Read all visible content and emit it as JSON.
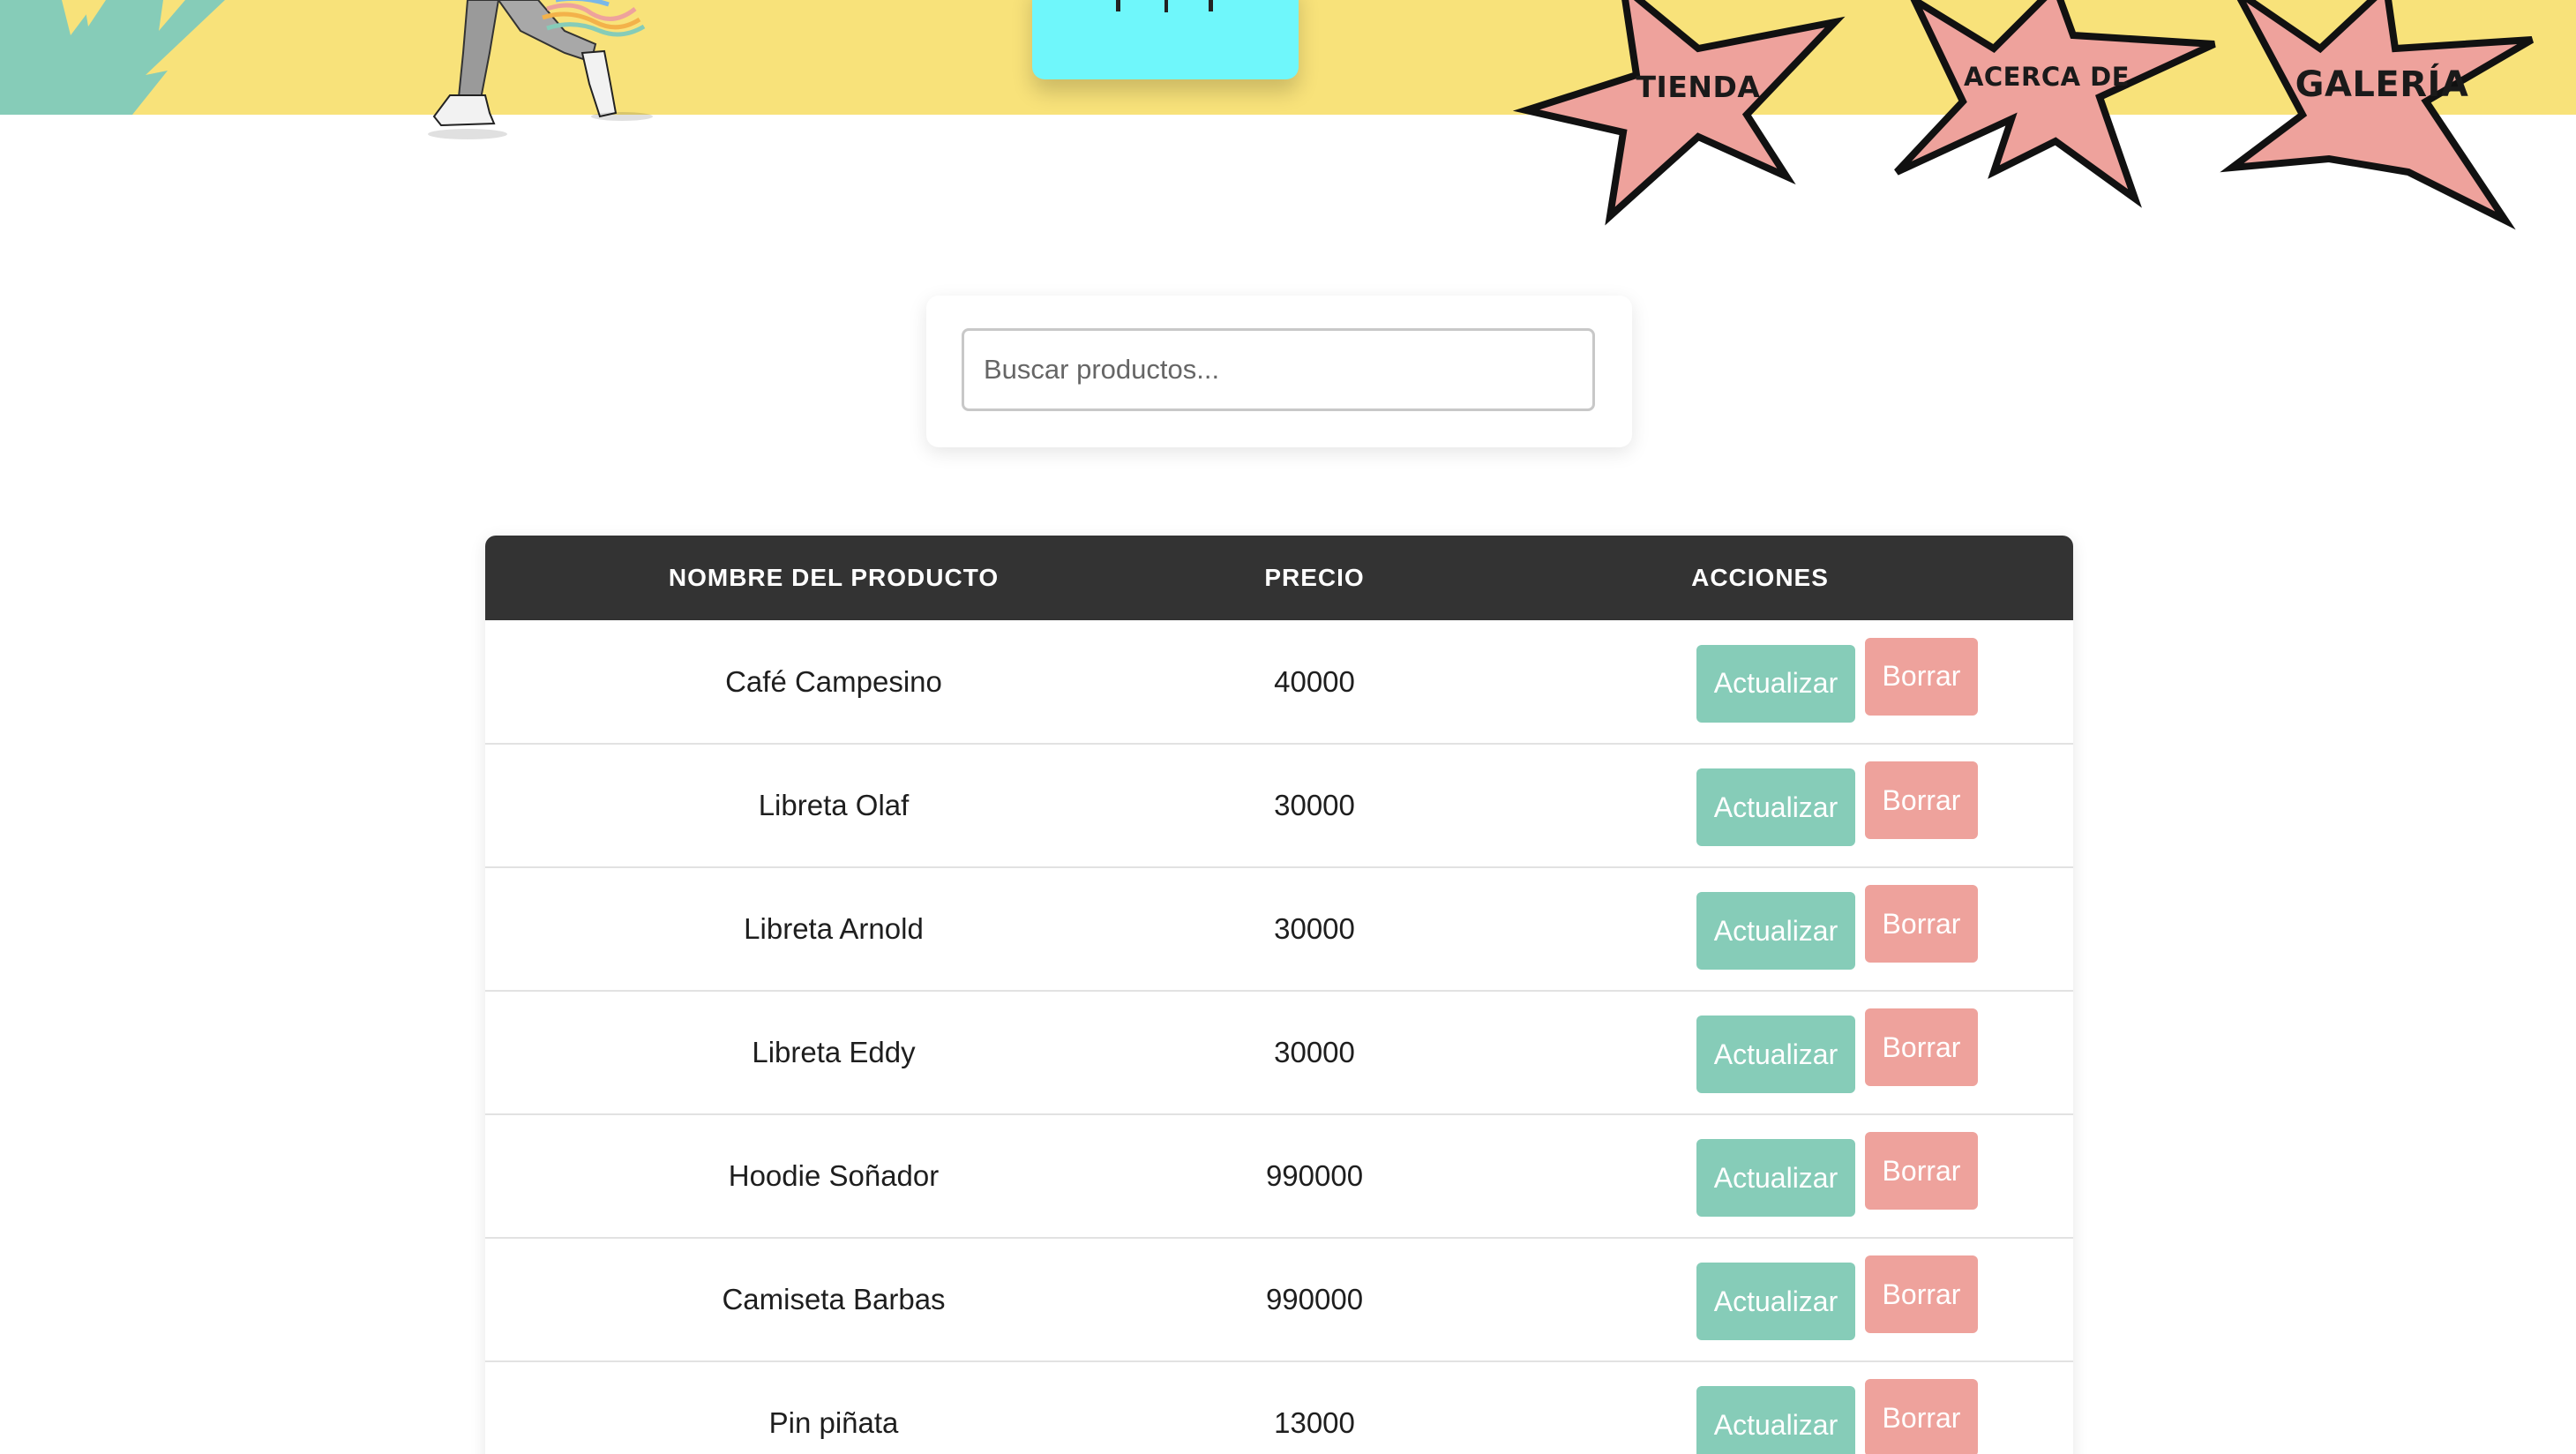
{
  "nav": {
    "items": [
      {
        "label": "TIENDA"
      },
      {
        "label": "ACERCA DE"
      },
      {
        "label": "GALERÍA"
      }
    ]
  },
  "colors": {
    "header_bg": "#f8e27a",
    "leaf": "#86ccb8",
    "logo_bg": "#6ff7fb",
    "star_fill": "#eea29c",
    "table_header_bg": "#333333",
    "update_button": "#86ccb8",
    "delete_button": "#eea29c"
  },
  "search": {
    "placeholder": "Buscar productos...",
    "value": ""
  },
  "table": {
    "headers": {
      "name": "NOMBRE DEL PRODUCTO",
      "price": "PRECIO",
      "actions": "ACCIONES"
    },
    "update_label": "Actualizar",
    "delete_label": "Borrar",
    "rows": [
      {
        "name": "Café Campesino",
        "price": "40000"
      },
      {
        "name": "Libreta Olaf",
        "price": "30000"
      },
      {
        "name": "Libreta Arnold",
        "price": "30000"
      },
      {
        "name": "Libreta Eddy",
        "price": "30000"
      },
      {
        "name": "Hoodie Soñador",
        "price": "990000"
      },
      {
        "name": "Camiseta Barbas",
        "price": "990000"
      },
      {
        "name": "Pin piñata",
        "price": "13000"
      }
    ]
  }
}
